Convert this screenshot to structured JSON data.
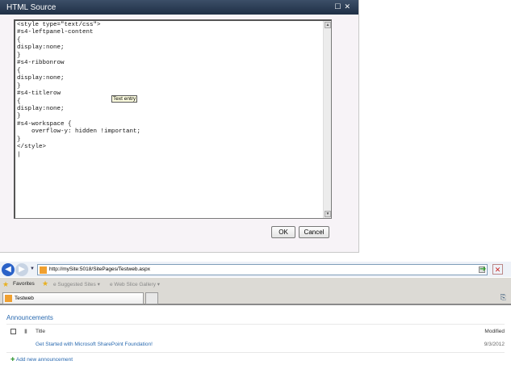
{
  "dialog": {
    "title": "HTML Source",
    "code": "<style type=\"text/css\">\n#s4-leftpanel-content\n{\ndisplay:none;\n}\n#s4-ribbonrow\n{\ndisplay:none;\n}\n#s4-titlerow\n{\ndisplay:none;\n}\n#s4-workspace {\n    overflow-y: hidden !important;\n}\n</style>\n|",
    "tooltip": "Text entry",
    "ok_label": "OK",
    "cancel_label": "Cancel"
  },
  "browser": {
    "url": "http://mySite:5018/SitePages/Testweb.aspx",
    "favorites_label": "Favorites",
    "suggested_sites": "Suggested Sites",
    "web_slice_gallery": "Web Slice Gallery",
    "tab_title": "Testweb"
  },
  "page": {
    "section_title": "Announcements",
    "columns": {
      "title": "Title",
      "modified": "Modified"
    },
    "items": [
      {
        "title": "Get Started with Microsoft SharePoint Foundation!",
        "modified": "9/3/2012"
      }
    ],
    "add_label": "Add new announcement"
  }
}
